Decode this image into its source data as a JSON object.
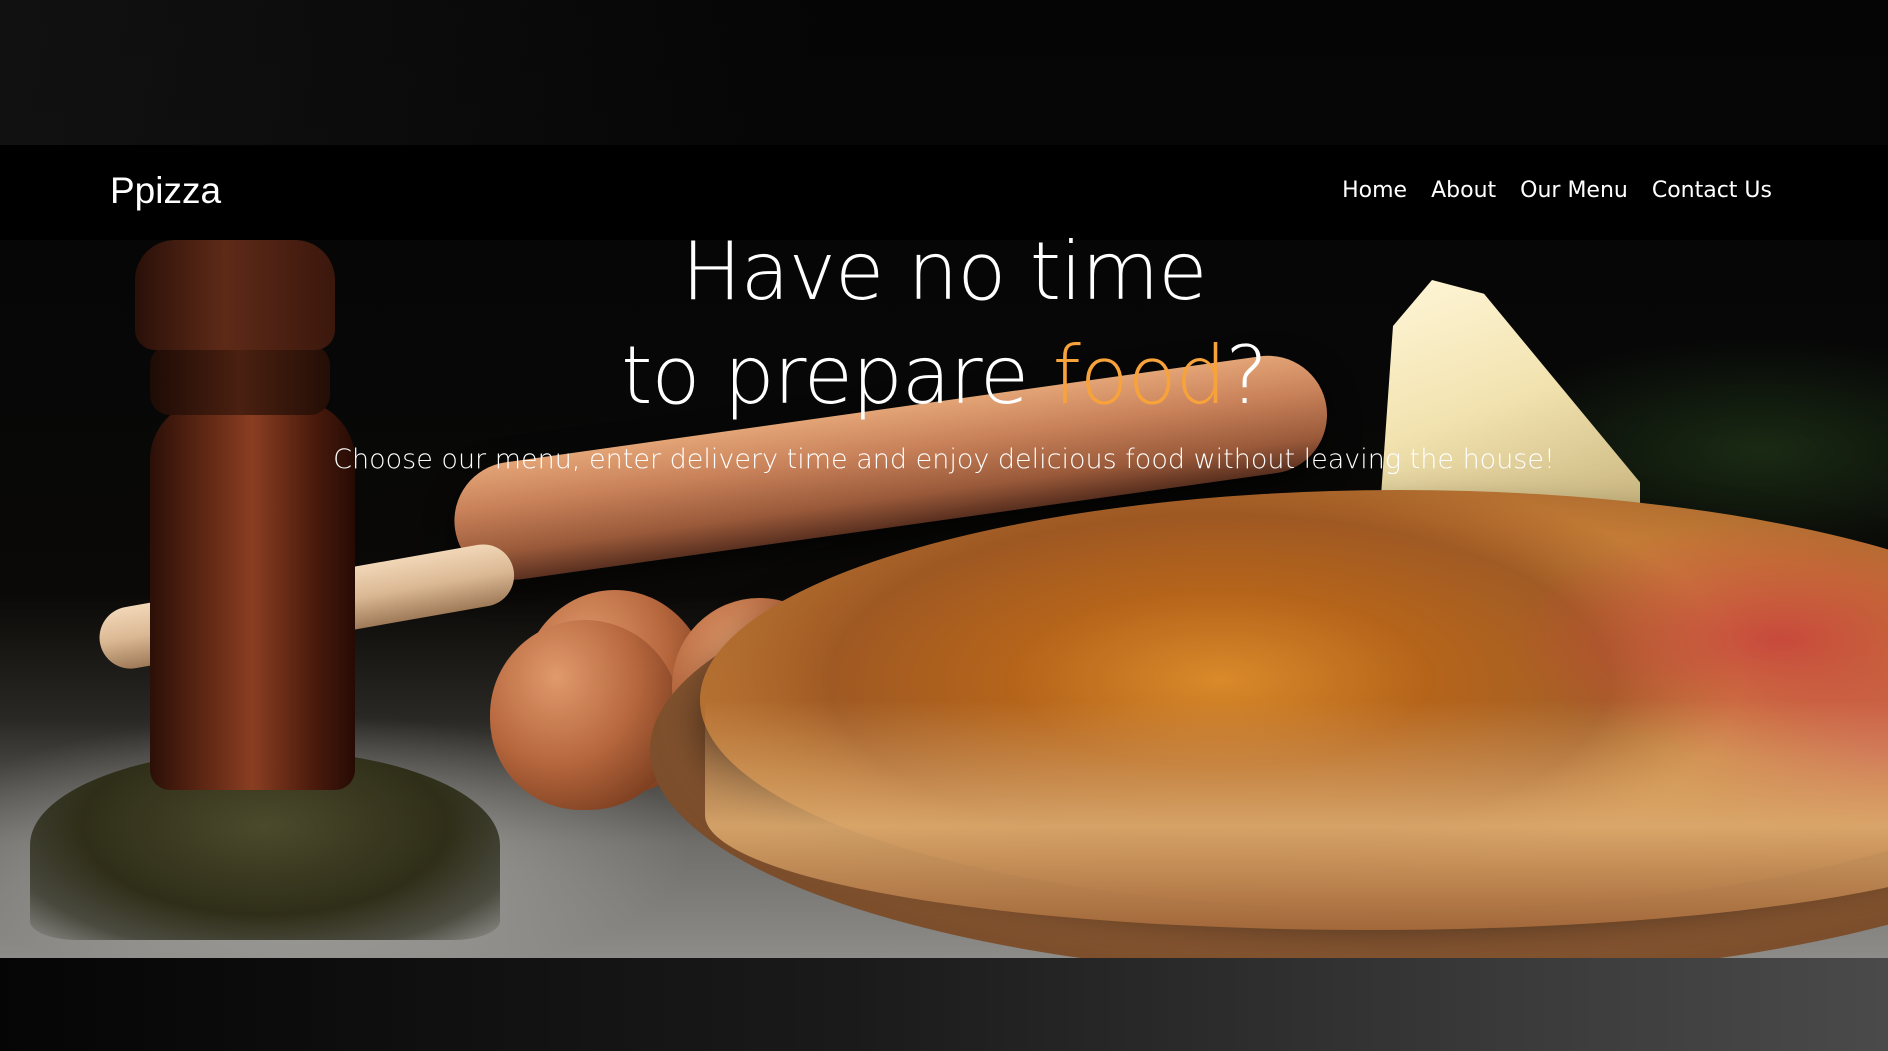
{
  "brand": {
    "name": "Ppizza"
  },
  "nav": {
    "items": [
      {
        "label": "Home"
      },
      {
        "label": "About"
      },
      {
        "label": "Our Menu"
      },
      {
        "label": "Contact Us"
      }
    ]
  },
  "hero": {
    "headline_line1": "Have no time",
    "headline_line2_prefix": "to prepare ",
    "headline_accent": "food",
    "headline_line2_suffix": "?",
    "subtitle": "Choose our menu, enter delivery time and enjoy delicious food without leaving the house!",
    "background": "pizza-food-scene-image"
  },
  "colors": {
    "accent": "#f7a23b",
    "text": "#ffffff",
    "navbar": "#000000"
  }
}
